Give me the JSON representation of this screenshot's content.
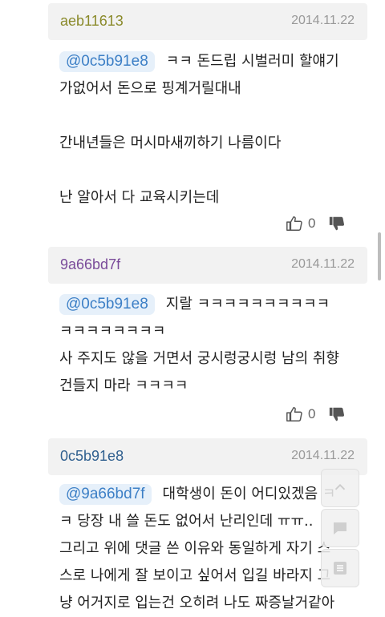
{
  "comments": [
    {
      "author": "aeb11613",
      "author_color": "#8a8a2a",
      "date": "2014.11.22",
      "mention": "@0c5b91e8",
      "lines": [
        "ㅋㅋ 돈드립 시벌러미 할얘기",
        "가없어서 돈으로 핑계거릴대내",
        "",
        "간내년들은 머시마새끼하기 나름이다",
        "",
        "난 알아서 다 교육시키는데"
      ],
      "votes": "0"
    },
    {
      "author": "9a66bd7f",
      "author_color": "#7a4b9a",
      "date": "2014.11.22",
      "mention": "@0c5b91e8",
      "lines": [
        "지랄 ㅋㅋㅋㅋㅋㅋㅋㅋㅋㅋ",
        "ㅋㅋㅋㅋㅋㅋㅋㅋ",
        "사 주지도 않을 거면서 궁시렁궁시렁 남의 취향",
        "건들지 마라 ㅋㅋㅋㅋ"
      ],
      "votes": "0"
    },
    {
      "author": "0c5b91e8",
      "author_color": "#2f5f8f",
      "date": "2014.11.22",
      "mention": "@9a66bd7f",
      "lines": [
        "대학생이 돈이 어디있겠음 ㅋ",
        "ㅋ 당장 내 쓸 돈도 없어서 난리인데 ㅠㅠ..",
        "그리고 위에 댓글 쓴 이유와 동일하게 자기 스",
        "스로 나에게 잘 보이고 싶어서 입길 바라지 그",
        "냥 어거지로 입는건 오히려 나도 짜증날거같아"
      ],
      "votes": ""
    }
  ]
}
